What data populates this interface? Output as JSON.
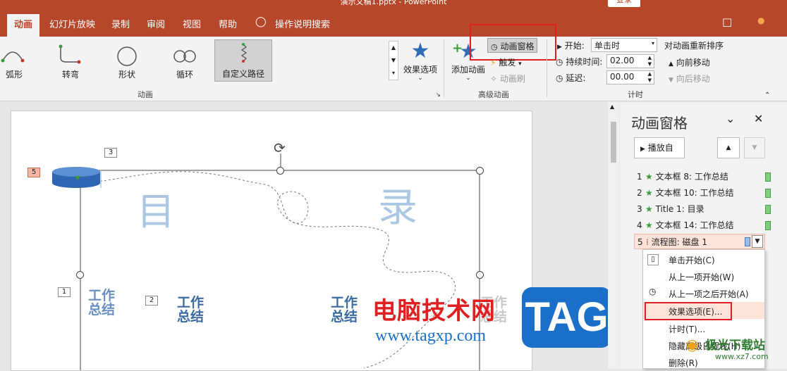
{
  "window": {
    "title": "演示文稿1.pptx  -  PowerPoint",
    "login_label": "登录"
  },
  "tabs": [
    {
      "label": "动画",
      "active": true
    },
    {
      "label": "幻灯片放映"
    },
    {
      "label": "录制"
    },
    {
      "label": "审阅"
    },
    {
      "label": "视图"
    },
    {
      "label": "帮助"
    },
    {
      "label": "操作说明搜索"
    }
  ],
  "ribbon": {
    "paths": [
      {
        "label": "弧形",
        "icon": "arc-path-icon"
      },
      {
        "label": "转弯",
        "icon": "turn-path-icon"
      },
      {
        "label": "形状",
        "icon": "shape-path-icon"
      },
      {
        "label": "循环",
        "icon": "loop-path-icon"
      },
      {
        "label": "自定义路径",
        "icon": "custom-path-icon",
        "selected": true
      }
    ],
    "effect_options": "效果选项",
    "group_animation": "动画",
    "add_animation": "添加动画",
    "animation_pane": "动画窗格",
    "trigger": "触发",
    "animation_painter": "动画刷",
    "group_advanced": "高级动画",
    "start_label": "开始:",
    "start_value": "单击时",
    "duration_label": "持续时间:",
    "duration_value": "02.00",
    "delay_label": "延迟:",
    "delay_value": "00.00",
    "group_timing": "计时",
    "reorder_title": "对动画重新排序",
    "move_earlier": "向前移动",
    "move_later": "向后移动"
  },
  "slide": {
    "title_chars": [
      "目",
      "录"
    ],
    "items": [
      "工作\n总结",
      "工作\n总结",
      "工作\n总结",
      "工作\n总结"
    ],
    "numbers": [
      "5",
      "3",
      "1",
      "2"
    ]
  },
  "pane": {
    "title": "动画窗格",
    "play_label": "播放自",
    "items": [
      {
        "num": "1",
        "label": "文本框 8: 工作总结"
      },
      {
        "num": "2",
        "label": "文本框 10: 工作总结"
      },
      {
        "num": "3",
        "label": "Title 1: 目录"
      },
      {
        "num": "4",
        "label": "文本框 14: 工作总结"
      },
      {
        "num": "5",
        "label": "流程图: 磁盘 1"
      }
    ]
  },
  "context_menu": {
    "items": [
      "单击开始(C)",
      "从上一项开始(W)",
      "从上一项之后开始(A)",
      "效果选项(E)...",
      "计时(T)...",
      "隐藏高级日程表(H)",
      "删除(R)"
    ]
  },
  "watermark": {
    "site_title": "电脑技术网",
    "site_url": "www.tagxp.com",
    "badge": "TAG",
    "corner_title": "极光下载站",
    "corner_url": "www.xz7.com"
  },
  "colors": {
    "accent": "#b7472a",
    "highlight": "#e02020",
    "watermark_red": "#e02020",
    "badge_blue": "#1a6fc9"
  }
}
